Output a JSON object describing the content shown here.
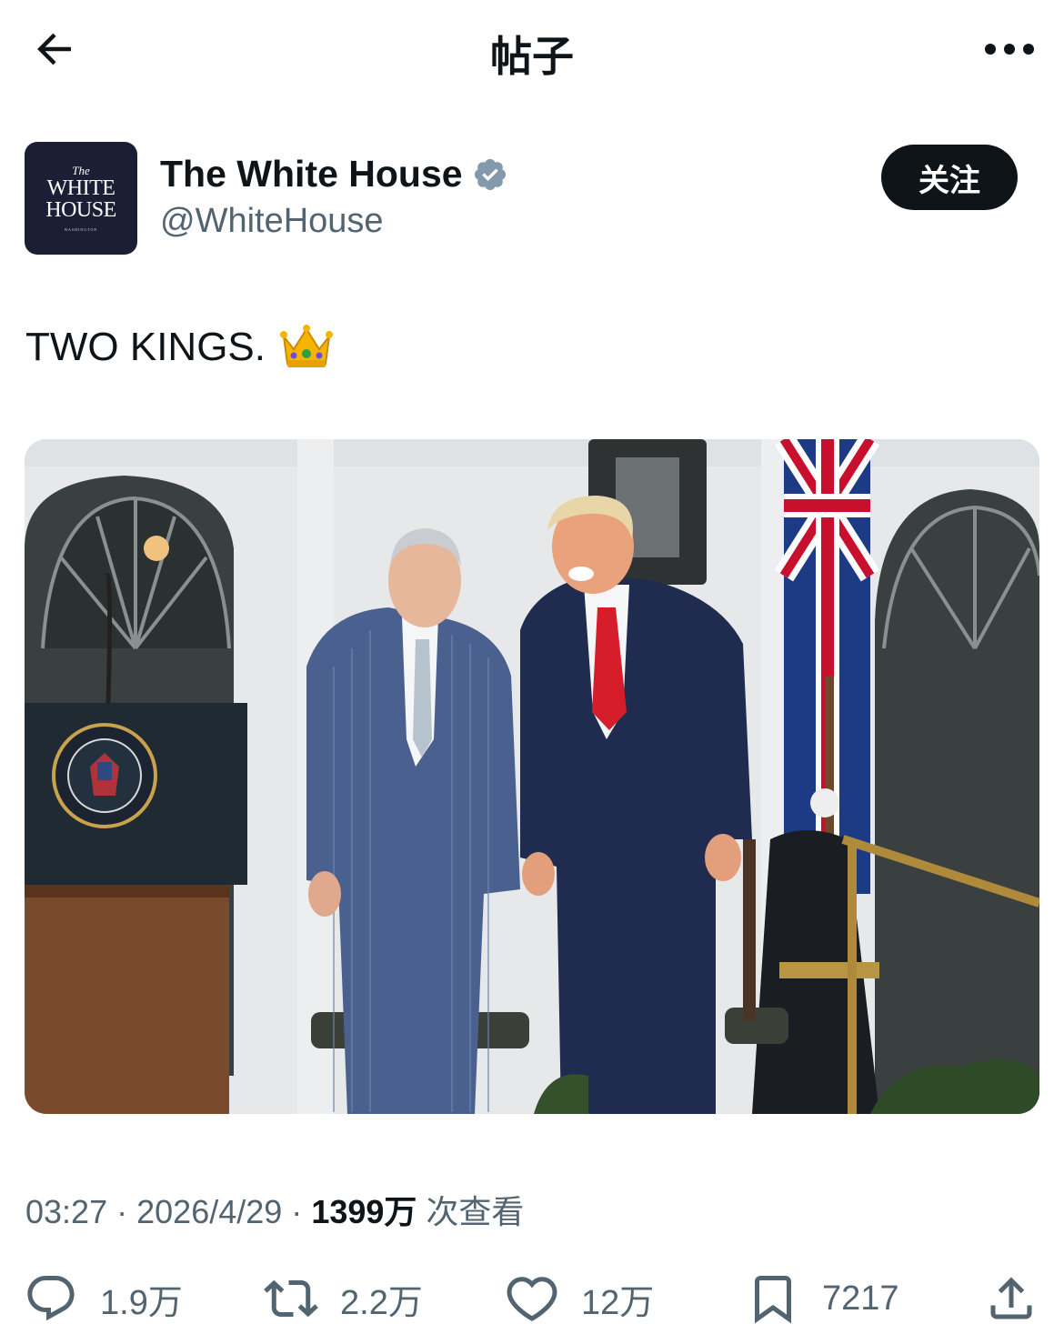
{
  "header": {
    "title": "帖子",
    "back_icon": "arrow-left-icon",
    "more_icon": "more-horizontal-icon"
  },
  "author": {
    "name": "The White House",
    "handle": "@WhiteHouse",
    "verified_icon": "verified-badge-icon",
    "follow_label": "关注",
    "avatar": {
      "line1": "The",
      "line2": "WHITE",
      "line3": "HOUSE",
      "line4": "WASHINGTON"
    }
  },
  "post": {
    "text": "TWO KINGS.",
    "emoji": "crown-emoji"
  },
  "meta": {
    "time": "03:27",
    "sep1": "·",
    "date": "2026/4/29",
    "sep2": "·",
    "views_count": "1399万",
    "views_label": "次查看"
  },
  "actions": {
    "replies": "1.9万",
    "reposts": "2.2万",
    "likes": "12万",
    "bookmarks": "7217"
  },
  "colors": {
    "text_primary": "#0f1419",
    "text_secondary": "#536471",
    "verified": "#829aab"
  }
}
